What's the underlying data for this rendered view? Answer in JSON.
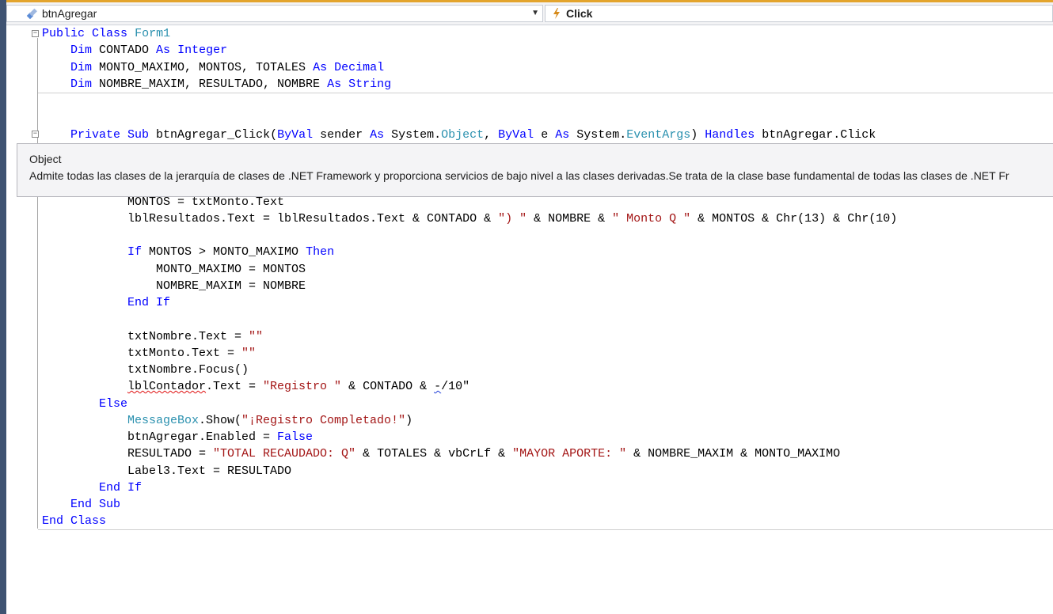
{
  "navbar": {
    "left_combo": {
      "label": "btnAgregar",
      "icon": "control-icon"
    },
    "right_combo": {
      "label": "Click",
      "icon": "lightning-event-icon"
    }
  },
  "colors": {
    "keyword": "#0000ff",
    "type": "#2b91af",
    "string": "#a31515",
    "accent": "#e3a42d"
  },
  "code": {
    "l1": [
      "Public",
      " ",
      "Class",
      " ",
      "Form1"
    ],
    "l2": [
      "Dim",
      " CONTADO ",
      "As",
      " ",
      "Integer"
    ],
    "l3": [
      "Dim",
      " MONTO_MAXIMO, MONTOS, TOTALES ",
      "As",
      " ",
      "Decimal"
    ],
    "l4": [
      "Dim",
      " NOMBRE_MAXIM, RESULTADO, NOMBRE ",
      "As",
      " ",
      "String"
    ],
    "l5": [
      "Private",
      " ",
      "Sub",
      " btnAgregar_Click(",
      "ByVal",
      " sender ",
      "As",
      " System.",
      "Object",
      ", ",
      "ByVal",
      " e ",
      "As",
      " System.",
      "EventArgs",
      ") ",
      "Handles",
      " btnAgregar.Click"
    ],
    "l6": [
      "MONTOS = txtMonto.Text"
    ],
    "l7": [
      "lblResultados.Text = lblResultados.Text & CONTADO & ",
      "\") \"",
      " & NOMBRE & ",
      "\" Monto Q \"",
      " & MONTOS & Chr(13) & Chr(10)"
    ],
    "l8": [
      "If",
      " MONTOS > MONTO_MAXIMO ",
      "Then"
    ],
    "l9": [
      "MONTO_MAXIMO = MONTOS"
    ],
    "l10": [
      "NOMBRE_MAXIM = NOMBRE"
    ],
    "l11": [
      "End If"
    ],
    "l12": [
      "txtNombre.Text = ",
      "\"\""
    ],
    "l13": [
      "txtMonto.Text = ",
      "\"\""
    ],
    "l14": [
      "txtNombre.Focus()"
    ],
    "l15": [
      "lblContador",
      ".Text = ",
      "\"Registro \"",
      " & CONTADO & ",
      "-",
      "/10\""
    ],
    "l16": [
      "Else"
    ],
    "l17": [
      "MessageBox",
      ".Show(",
      "\"¡Registro Completado!\"",
      ")"
    ],
    "l18": [
      "btnAgregar.Enabled = ",
      "False"
    ],
    "l19": [
      "RESULTADO = ",
      "\"TOTAL RECAUDADO: Q\"",
      " & TOTALES & vbCrLf & ",
      "\"MAYOR APORTE: \"",
      " & NOMBRE_MAXIM & MONTO_MAXIMO"
    ],
    "l20": [
      "Label3.Text = RESULTADO"
    ],
    "l21": [
      "End If"
    ],
    "l22": [
      "End Sub"
    ],
    "l23": [
      "End Class"
    ]
  },
  "tooltip": {
    "title": "Object",
    "description": "Admite todas las clases de la jerarquía de clases de .NET Framework y proporciona servicios de bajo nivel a las clases derivadas.Se trata de la clase base fundamental de todas las clases de .NET Fr"
  }
}
